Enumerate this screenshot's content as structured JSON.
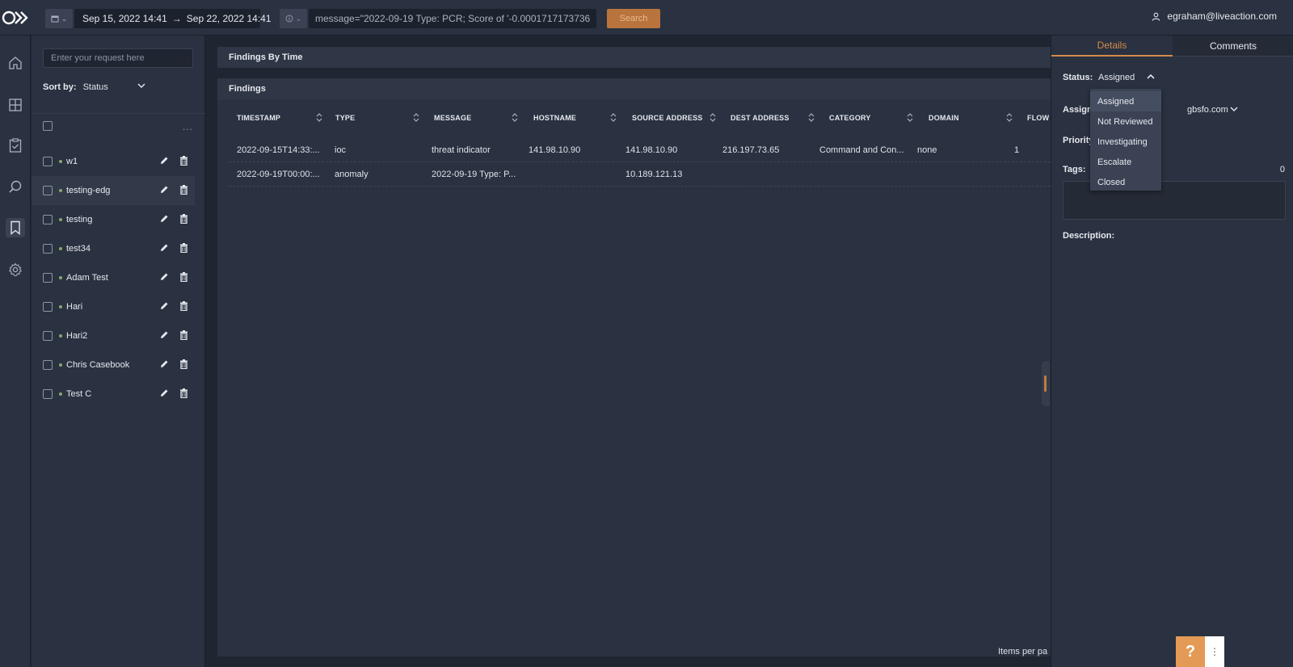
{
  "topbar": {
    "date_range": {
      "start": "Sep 15, 2022 14:41",
      "arrow": "→",
      "end": "Sep 22, 2022 14:41"
    },
    "query": "message=\"2022-09-19 Type: PCR; Score of '-0.0001717173736",
    "search_label": "Search",
    "user": "egraham@liveaction.com"
  },
  "rail": {
    "icons": [
      "home-icon",
      "dashboard-icon",
      "clipboard-check-icon",
      "search-icon",
      "bookmark-icon",
      "settings-icon"
    ]
  },
  "casebook": {
    "search_placeholder": "Enter your request here",
    "sort_label": "Sort by:",
    "sort_value": "Status",
    "more": "...",
    "items": [
      {
        "name": "w1"
      },
      {
        "name": "testing-edg"
      },
      {
        "name": "testing"
      },
      {
        "name": "test34"
      },
      {
        "name": "Adam Test"
      },
      {
        "name": "Hari"
      },
      {
        "name": "Hari2"
      },
      {
        "name": "Chris Casebook"
      },
      {
        "name": "Test C"
      }
    ]
  },
  "main": {
    "findings_by_time_title": "Findings By Time",
    "findings_title": "Findings",
    "columns": [
      "TIMESTAMP",
      "TYPE",
      "MESSAGE",
      "HOSTNAME",
      "SOURCE ADDRESS",
      "DEST ADDRESS",
      "CATEGORY",
      "DOMAIN",
      "FLOW"
    ],
    "rows": [
      {
        "timestamp": "2022-09-15T14:33:...",
        "type": "ioc",
        "message": "threat indicator",
        "hostname": "141.98.10.90",
        "source": "141.98.10.90",
        "dest": "216.197.73.65",
        "category": "Command and Con...",
        "domain": "none",
        "flow": "1"
      },
      {
        "timestamp": "2022-09-19T00:00:...",
        "type": "anomaly",
        "message": "2022-09-19 Type: P...",
        "hostname": "",
        "source": "10.189.121.13",
        "dest": "",
        "category": "",
        "domain": "",
        "flow": ""
      }
    ],
    "items_per_page_label": "Items per pa"
  },
  "details": {
    "tabs": [
      "Details",
      "Comments"
    ],
    "status_label": "Status:",
    "status_value": "Assigned",
    "assignee_label": "Assign",
    "assignee_value": "gbsfo.com",
    "priority_label": "Priority",
    "tags_label": "Tags:",
    "tags_count": "0",
    "description_label": "Description:",
    "status_options": [
      "Assigned",
      "Not Reviewed",
      "Investigating",
      "Escalate",
      "Closed"
    ]
  },
  "help": {
    "label": "?",
    "more": "⋮"
  },
  "colors": {
    "accent": "#d58a4a",
    "search_button": "#b9743d",
    "bg": "#1f2531",
    "panel": "#2a3140",
    "dot": "#86a96b"
  }
}
